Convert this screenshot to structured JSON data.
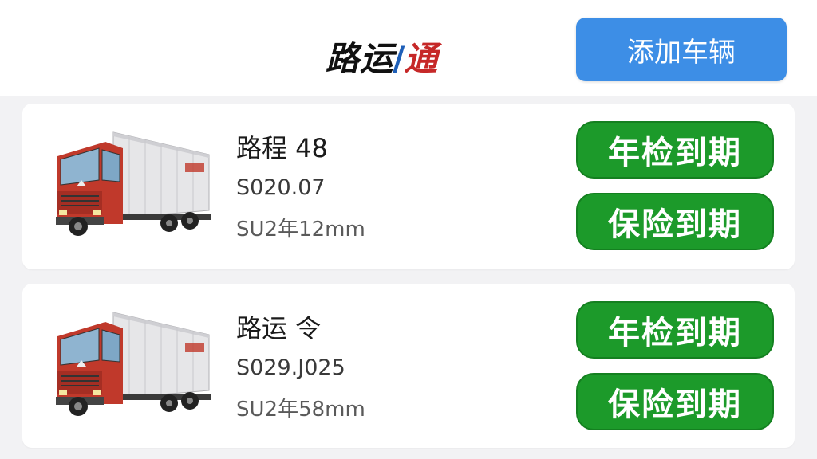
{
  "header": {
    "logo_part1": "路运",
    "logo_slash": "/",
    "logo_part2": "通",
    "add_button_label": "添加车辆"
  },
  "vehicles": [
    {
      "name": "路程 48",
      "code": "S020.07",
      "detail": "SU2年12mm",
      "badges": [
        "年检到期",
        "保险到期"
      ]
    },
    {
      "name": "路运 令",
      "code": "S029.J025",
      "detail": "SU2年58mm",
      "badges": [
        "年检到期",
        "保险到期"
      ]
    }
  ],
  "colors": {
    "accent_blue": "#3d8ee6",
    "badge_green": "#1c9a2a",
    "logo_red": "#c62828"
  }
}
